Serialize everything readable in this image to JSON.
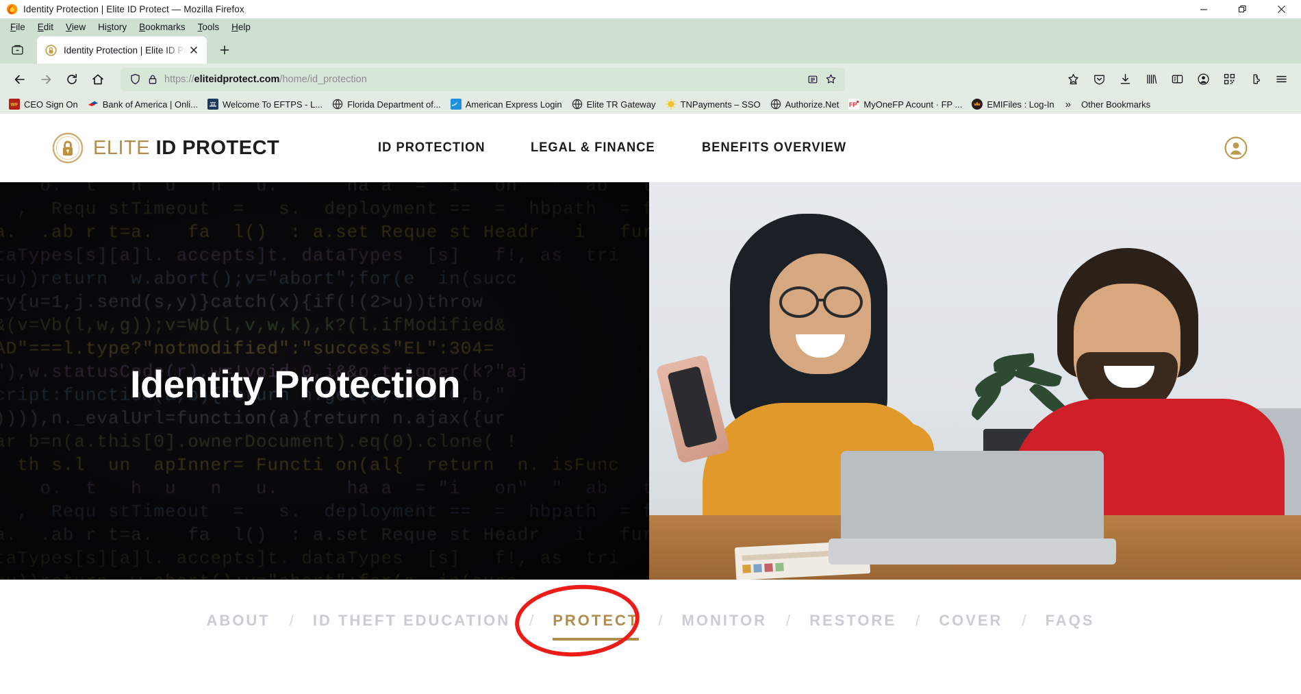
{
  "browser": {
    "window_title": "Identity Protection | Elite ID Protect — Mozilla Firefox",
    "menus": [
      "File",
      "Edit",
      "View",
      "History",
      "Bookmarks",
      "Tools",
      "Help"
    ],
    "window_controls": [
      "minimize-icon",
      "restore-icon",
      "close-icon"
    ],
    "tab": {
      "title": "Identity Protection | Elite ID Pro",
      "favicon": "gold-lock-icon",
      "close_label": "close-tab-icon"
    },
    "new_tab_label": "new-tab-icon",
    "tab_list_label": "list-all-tabs-icon",
    "nav": {
      "back": "back-arrow-icon",
      "forward": "forward-arrow-icon",
      "reload": "reload-icon",
      "home": "home-icon"
    },
    "url": {
      "scheme": "https://",
      "host": "eliteidprotect.com",
      "path": "/home/id_protection",
      "full": "https://eliteidprotect.com/home/id_protection",
      "shield_icon": "tracking-protection-shield-icon",
      "lock_icon": "padlock-icon",
      "reader_icon": "reader-view-icon",
      "bookmark_icon": "bookmark-star-icon"
    },
    "toolbar_icons": [
      "save-to-pocket-star-icon",
      "pocket-shield-icon",
      "downloads-icon",
      "library-icon",
      "sidebar-icon",
      "account-icon",
      "qr-code-icon",
      "extensions-icon",
      "application-menu-icon"
    ],
    "bookmarks": [
      {
        "label": "CEO Sign On",
        "icon": "wells-fargo-icon",
        "color": "#b32017"
      },
      {
        "label": "Bank of America | Onli...",
        "icon": "bank-of-america-icon",
        "color": "#e11b22"
      },
      {
        "label": "Welcome To EFTPS - L...",
        "icon": "eftps-icon",
        "color": "#1c3a5e"
      },
      {
        "label": "Florida Department of...",
        "icon": "globe-icon",
        "color": "#2b2b2b"
      },
      {
        "label": "American Express Login",
        "icon": "amex-icon",
        "color": "#1e90e0"
      },
      {
        "label": "Elite TR Gateway",
        "icon": "globe-icon",
        "color": "#2b2b2b"
      },
      {
        "label": "TNPayments – SSO",
        "icon": "sun-icon",
        "color": "#f4c131"
      },
      {
        "label": "Authorize.Net",
        "icon": "globe-icon",
        "color": "#2b2b2b"
      },
      {
        "label": "MyOneFP Acount · FP ...",
        "icon": "fp-icon",
        "color": "#e0202a"
      },
      {
        "label": "EMIFiles : Log-In",
        "icon": "crown-icon",
        "color": "#2a1a18"
      }
    ],
    "overflow_label": "»",
    "other_bookmarks": {
      "label": "Other Bookmarks",
      "icon": "folder-icon"
    }
  },
  "site": {
    "logo": {
      "mark": "gold-circle-lock-icon",
      "word_light": "ELITE",
      "word_bold": "ID PROTECT"
    },
    "nav": [
      {
        "label": "ID PROTECTION"
      },
      {
        "label": "LEGAL & FINANCE"
      },
      {
        "label": "BENEFITS OVERVIEW"
      }
    ],
    "account_icon": "user-account-icon",
    "hero": {
      "title": "Identity Protection",
      "left_panel": "code-background-image",
      "right_panel": "couple-with-laptop-photo"
    },
    "subnav": {
      "separator": "/",
      "items": [
        {
          "label": "ABOUT",
          "active": false
        },
        {
          "label": "ID THEFT EDUCATION",
          "active": false
        },
        {
          "label": "PROTECT",
          "active": true
        },
        {
          "label": "MONITOR",
          "active": false
        },
        {
          "label": "RESTORE",
          "active": false
        },
        {
          "label": "COVER",
          "active": false
        },
        {
          "label": "FAQS",
          "active": false
        }
      ],
      "annotation": "red-ellipse-highlight"
    }
  },
  "colors": {
    "brand_gold": "#b08d4f",
    "annotation_red": "#ee1b17",
    "chrome_green": "#cfe0d0",
    "inactive_gray": "#c9ccd1"
  },
  "code_lines": [
    "    o.  t   h  u   n   u.      ha a  = \"i   on\"  \"  ab   t",
    "  ,  Requ stTimeout  =   s.  deployment ==  =  hbpath  = f",
    "a.  .ab r t=a.   fa  l()  : a.set Reque st Headr   i   fur",
    "taTypes[s][a]l. accepts]t. dataTypes  [s]   f!, as  tri",
    "=u))return  w.abort();v=\"abort\";for(e  in(succ",
    "ry{u=1,j.send(s,y)}catch(x){if(!(2>u))throw",
    "&(v=Vb(l,w,g));v=Wb(l,v,w,k),k?(l.ifModified&",
    "AD\"===l.type?\"notmodified\":\"success\"EL\":304=",
    "\"),w.statusCode(r),w=!void 0,i&&o.trigger(k?\"aj",
    "cript:function(a,b){return n.get(a,void 0,b,\"",
    ")))),n._evalUrl=function(a){return n.ajax({ur",
    "ar b=n(a.this[0].ownerDocument).eq(0).clone( !",
    "  th s.l  un  apInner= Functi on(al{  return  n. isFunc"
  ]
}
